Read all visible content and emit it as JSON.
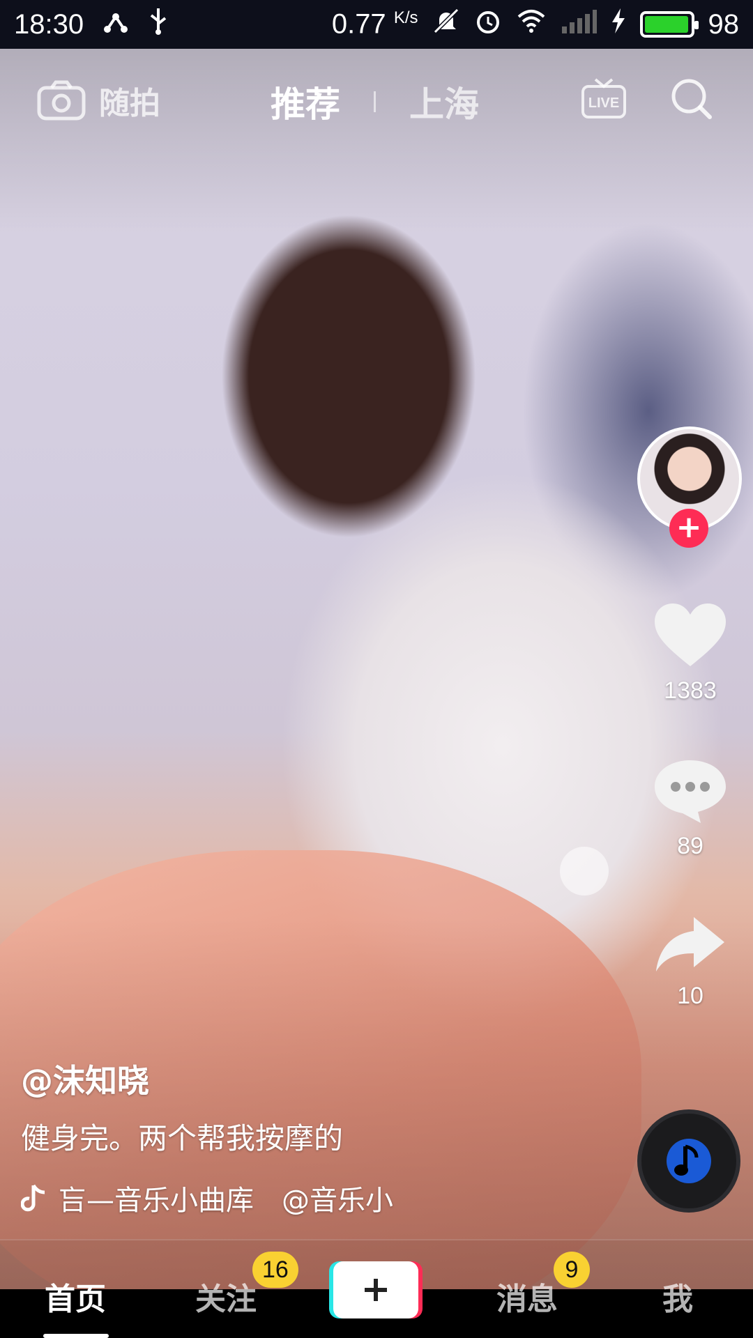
{
  "status_bar": {
    "time": "18:30",
    "net_speed": "0.77",
    "net_unit": "K/s",
    "battery": "98",
    "battery_level": 0.98
  },
  "top_nav": {
    "snap_label": "随拍",
    "tab_recommend": "推荐",
    "tab_city": "上海",
    "live_icon": "live-icon",
    "search_icon": "search-icon"
  },
  "video": {
    "author": "@沫知晓",
    "description": "健身完。两个帮我按摩的",
    "music": "吂—音乐小曲库　@音乐小"
  },
  "actions": {
    "likes": "1383",
    "comments": "89",
    "shares": "10"
  },
  "bottom_nav": {
    "home": "首页",
    "follow": "关注",
    "follow_badge": "16",
    "messages": "消息",
    "messages_badge": "9",
    "me": "我"
  },
  "colors": {
    "accent_red": "#fe2c55",
    "accent_cyan": "#29e6e6",
    "badge_yellow": "#f9d132",
    "battery_green": "#2bd12b"
  }
}
